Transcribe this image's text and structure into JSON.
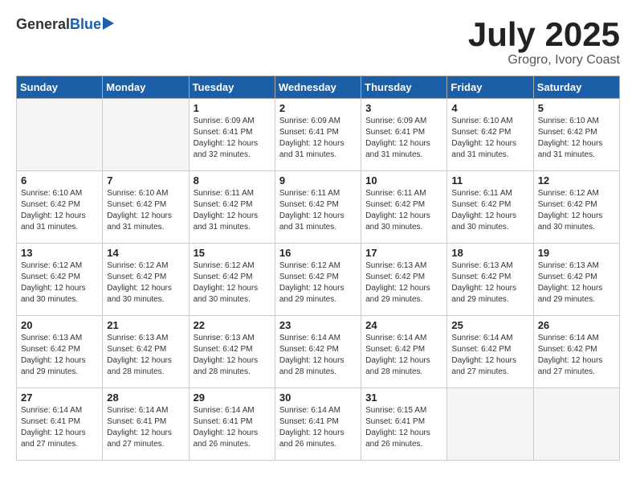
{
  "header": {
    "logo_general": "General",
    "logo_blue": "Blue",
    "month": "July 2025",
    "location": "Grogro, Ivory Coast"
  },
  "weekdays": [
    "Sunday",
    "Monday",
    "Tuesday",
    "Wednesday",
    "Thursday",
    "Friday",
    "Saturday"
  ],
  "weeks": [
    [
      {
        "day": "",
        "empty": true
      },
      {
        "day": "",
        "empty": true
      },
      {
        "day": "1",
        "sunrise": "6:09 AM",
        "sunset": "6:41 PM",
        "daylight": "12 hours and 32 minutes."
      },
      {
        "day": "2",
        "sunrise": "6:09 AM",
        "sunset": "6:41 PM",
        "daylight": "12 hours and 31 minutes."
      },
      {
        "day": "3",
        "sunrise": "6:09 AM",
        "sunset": "6:41 PM",
        "daylight": "12 hours and 31 minutes."
      },
      {
        "day": "4",
        "sunrise": "6:10 AM",
        "sunset": "6:42 PM",
        "daylight": "12 hours and 31 minutes."
      },
      {
        "day": "5",
        "sunrise": "6:10 AM",
        "sunset": "6:42 PM",
        "daylight": "12 hours and 31 minutes."
      }
    ],
    [
      {
        "day": "6",
        "sunrise": "6:10 AM",
        "sunset": "6:42 PM",
        "daylight": "12 hours and 31 minutes."
      },
      {
        "day": "7",
        "sunrise": "6:10 AM",
        "sunset": "6:42 PM",
        "daylight": "12 hours and 31 minutes."
      },
      {
        "day": "8",
        "sunrise": "6:11 AM",
        "sunset": "6:42 PM",
        "daylight": "12 hours and 31 minutes."
      },
      {
        "day": "9",
        "sunrise": "6:11 AM",
        "sunset": "6:42 PM",
        "daylight": "12 hours and 31 minutes."
      },
      {
        "day": "10",
        "sunrise": "6:11 AM",
        "sunset": "6:42 PM",
        "daylight": "12 hours and 30 minutes."
      },
      {
        "day": "11",
        "sunrise": "6:11 AM",
        "sunset": "6:42 PM",
        "daylight": "12 hours and 30 minutes."
      },
      {
        "day": "12",
        "sunrise": "6:12 AM",
        "sunset": "6:42 PM",
        "daylight": "12 hours and 30 minutes."
      }
    ],
    [
      {
        "day": "13",
        "sunrise": "6:12 AM",
        "sunset": "6:42 PM",
        "daylight": "12 hours and 30 minutes."
      },
      {
        "day": "14",
        "sunrise": "6:12 AM",
        "sunset": "6:42 PM",
        "daylight": "12 hours and 30 minutes."
      },
      {
        "day": "15",
        "sunrise": "6:12 AM",
        "sunset": "6:42 PM",
        "daylight": "12 hours and 30 minutes."
      },
      {
        "day": "16",
        "sunrise": "6:12 AM",
        "sunset": "6:42 PM",
        "daylight": "12 hours and 29 minutes."
      },
      {
        "day": "17",
        "sunrise": "6:13 AM",
        "sunset": "6:42 PM",
        "daylight": "12 hours and 29 minutes."
      },
      {
        "day": "18",
        "sunrise": "6:13 AM",
        "sunset": "6:42 PM",
        "daylight": "12 hours and 29 minutes."
      },
      {
        "day": "19",
        "sunrise": "6:13 AM",
        "sunset": "6:42 PM",
        "daylight": "12 hours and 29 minutes."
      }
    ],
    [
      {
        "day": "20",
        "sunrise": "6:13 AM",
        "sunset": "6:42 PM",
        "daylight": "12 hours and 29 minutes."
      },
      {
        "day": "21",
        "sunrise": "6:13 AM",
        "sunset": "6:42 PM",
        "daylight": "12 hours and 28 minutes."
      },
      {
        "day": "22",
        "sunrise": "6:13 AM",
        "sunset": "6:42 PM",
        "daylight": "12 hours and 28 minutes."
      },
      {
        "day": "23",
        "sunrise": "6:14 AM",
        "sunset": "6:42 PM",
        "daylight": "12 hours and 28 minutes."
      },
      {
        "day": "24",
        "sunrise": "6:14 AM",
        "sunset": "6:42 PM",
        "daylight": "12 hours and 28 minutes."
      },
      {
        "day": "25",
        "sunrise": "6:14 AM",
        "sunset": "6:42 PM",
        "daylight": "12 hours and 27 minutes."
      },
      {
        "day": "26",
        "sunrise": "6:14 AM",
        "sunset": "6:42 PM",
        "daylight": "12 hours and 27 minutes."
      }
    ],
    [
      {
        "day": "27",
        "sunrise": "6:14 AM",
        "sunset": "6:41 PM",
        "daylight": "12 hours and 27 minutes."
      },
      {
        "day": "28",
        "sunrise": "6:14 AM",
        "sunset": "6:41 PM",
        "daylight": "12 hours and 27 minutes."
      },
      {
        "day": "29",
        "sunrise": "6:14 AM",
        "sunset": "6:41 PM",
        "daylight": "12 hours and 26 minutes."
      },
      {
        "day": "30",
        "sunrise": "6:14 AM",
        "sunset": "6:41 PM",
        "daylight": "12 hours and 26 minutes."
      },
      {
        "day": "31",
        "sunrise": "6:15 AM",
        "sunset": "6:41 PM",
        "daylight": "12 hours and 26 minutes."
      },
      {
        "day": "",
        "empty": true
      },
      {
        "day": "",
        "empty": true
      }
    ]
  ],
  "labels": {
    "sunrise": "Sunrise:",
    "sunset": "Sunset:",
    "daylight": "Daylight:"
  }
}
